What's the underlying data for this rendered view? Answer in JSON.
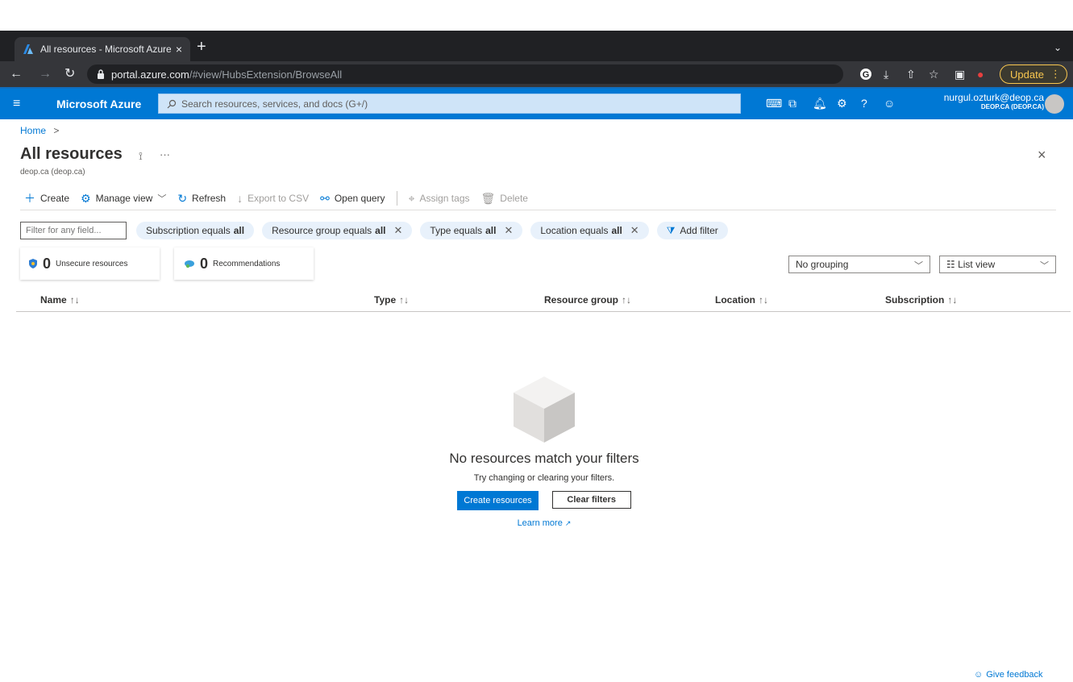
{
  "browser": {
    "tab_title": "All resources - Microsoft Azure",
    "tab_close": "×",
    "new_tab": "+",
    "tab_menu": "⌄",
    "url_host": "portal.azure.com",
    "url_path": "/#view/HubsExtension/BrowseAll",
    "update_label": "Update",
    "update_dots": "⋮"
  },
  "azure": {
    "brand": "Microsoft Azure",
    "search_placeholder": "Search resources, services, and docs (G+/)",
    "user_email": "nurgul.ozturk@deop.ca",
    "user_tenant": "DEOP.CA (DEOP.CA)",
    "accent": "#0078d4"
  },
  "breadcrumb": {
    "home": "Home",
    "sep": ">"
  },
  "page": {
    "title": "All resources",
    "subtitle": "deop.ca (deop.ca)",
    "pin": "⟟",
    "more": "···",
    "close": "×"
  },
  "toolbar": {
    "create": "Create",
    "manage_view": "Manage view",
    "refresh": "Refresh",
    "export_csv": "Export to CSV",
    "open_query": "Open query",
    "assign_tags": "Assign tags",
    "delete": "Delete"
  },
  "filters": {
    "input_placeholder": "Filter for any field...",
    "subscription": {
      "label": "Subscription equals",
      "value": "all"
    },
    "resource_group": {
      "label": "Resource group equals",
      "value": "all"
    },
    "type": {
      "label": "Type equals",
      "value": "all"
    },
    "location": {
      "label": "Location equals",
      "value": "all"
    },
    "add": "Add filter",
    "remove": "✕"
  },
  "cards": {
    "unsecure": {
      "count": "0",
      "label": "Unsecure resources"
    },
    "recommendations": {
      "count": "0",
      "label": "Recommendations"
    }
  },
  "dropdowns": {
    "grouping": "No grouping",
    "view": "☷ List view",
    "chev": "﹀"
  },
  "columns": {
    "name": "Name",
    "name_arrow": "↑↓",
    "type": "Type",
    "resource_group": "Resource group",
    "location": "Location",
    "subscription": "Subscription",
    "sort_arrow": "↑↓"
  },
  "empty": {
    "title": "No resources match your filters",
    "subtitle": "Try changing or clearing your filters.",
    "create_button": "Create resources",
    "clear_button": "Clear filters",
    "learn_more": "Learn more"
  },
  "feedback": "Give feedback"
}
